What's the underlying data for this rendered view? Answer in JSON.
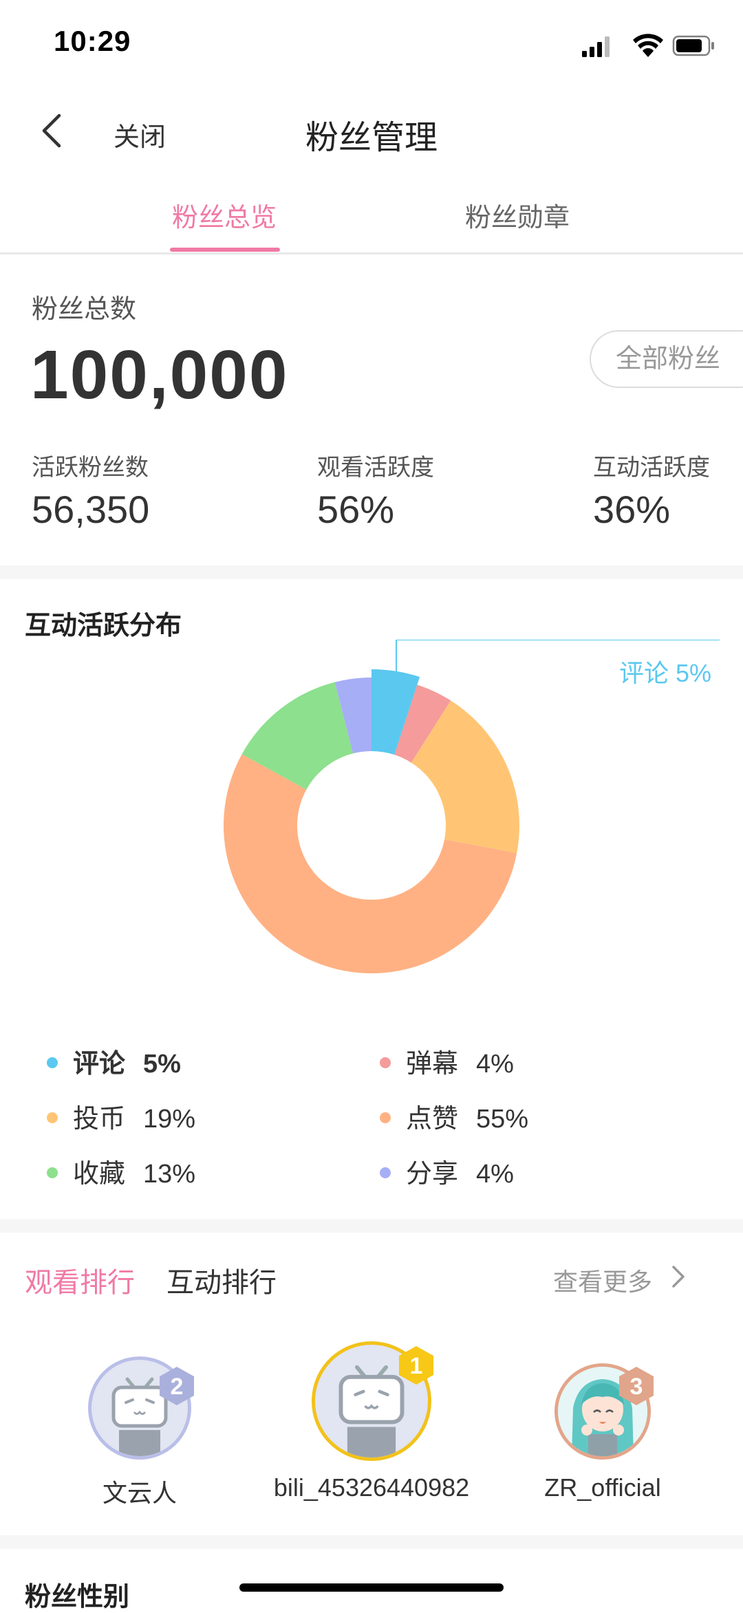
{
  "status_bar": {
    "time": "10:29"
  },
  "nav": {
    "close_label": "关闭",
    "title": "粉丝管理"
  },
  "tabs": [
    {
      "label": "粉丝总览",
      "active": true
    },
    {
      "label": "粉丝勋章",
      "active": false
    }
  ],
  "overview": {
    "total_label": "粉丝总数",
    "total_value": "100,000",
    "all_fans_button": "全部粉丝",
    "metrics": [
      {
        "label": "活跃粉丝数",
        "value": "56,350"
      },
      {
        "label": "观看活跃度",
        "value": "56%"
      },
      {
        "label": "互动活跃度",
        "value": "36%"
      }
    ]
  },
  "distribution": {
    "title": "互动活跃分布",
    "callout": "评论 5%",
    "legend": [
      {
        "name": "评论",
        "pct": "5%",
        "color": "#5bc8ef",
        "selected": true
      },
      {
        "name": "弹幕",
        "pct": "4%",
        "color": "#f59b9b"
      },
      {
        "name": "投币",
        "pct": "19%",
        "color": "#ffc574"
      },
      {
        "name": "点赞",
        "pct": "55%",
        "color": "#ffb183"
      },
      {
        "name": "收藏",
        "pct": "13%",
        "color": "#8de08d"
      },
      {
        "name": "分享",
        "pct": "4%",
        "color": "#a6aef6"
      }
    ]
  },
  "chart_data": {
    "type": "pie",
    "title": "互动活跃分布",
    "categories": [
      "评论",
      "弹幕",
      "投币",
      "点赞",
      "收藏",
      "分享"
    ],
    "values": [
      5,
      4,
      19,
      55,
      13,
      4
    ],
    "colors": [
      "#5bc8ef",
      "#f59b9b",
      "#ffc574",
      "#ffb183",
      "#8de08d",
      "#a6aef6"
    ],
    "donut": true,
    "highlighted": "评论"
  },
  "ranking": {
    "tabs": [
      {
        "label": "观看排行",
        "active": true
      },
      {
        "label": "互动排行",
        "active": false
      }
    ],
    "more_label": "查看更多",
    "entries": [
      {
        "rank": "2",
        "name": "文云人",
        "ring_color": "#b9bfe8",
        "badge_color": "#aab0dc"
      },
      {
        "rank": "1",
        "name": "bili_45326440982",
        "ring_color": "#f2c21b",
        "badge_color": "#f7c815"
      },
      {
        "rank": "3",
        "name": "ZR_official",
        "ring_color": "#e3a58a",
        "badge_color": "#e0a58a"
      }
    ]
  },
  "gender": {
    "title": "粉丝性别"
  }
}
